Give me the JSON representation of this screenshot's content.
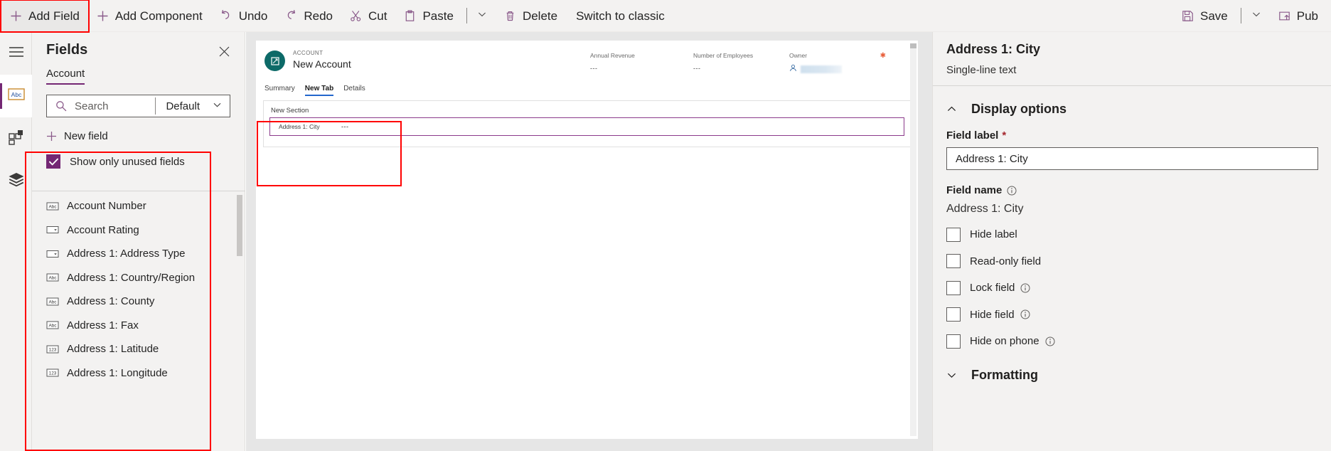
{
  "commandbar": {
    "left_items": [
      {
        "label": "Add Field",
        "icon": "plus-icon",
        "highlighted": true
      },
      {
        "label": "Add Component",
        "icon": "plus-icon"
      },
      {
        "label": "Undo",
        "icon": "undo-icon"
      },
      {
        "label": "Redo",
        "icon": "redo-icon"
      },
      {
        "label": "Cut",
        "icon": "scissors-icon"
      },
      {
        "label": "Paste",
        "icon": "clipboard-icon"
      },
      {
        "label": "Delete",
        "icon": "trash-icon"
      },
      {
        "label": "Switch to classic",
        "icon": "none"
      }
    ],
    "right_items": [
      {
        "label": "Save",
        "icon": "save-icon"
      },
      {
        "label": "Pub",
        "icon": "publish-icon"
      }
    ]
  },
  "rail": {
    "items": [
      {
        "name": "hamburger",
        "icon": "hamburger-icon",
        "active": false
      },
      {
        "name": "fields",
        "icon": "abc-box-icon",
        "active": true
      },
      {
        "name": "components",
        "icon": "components-grid-icon",
        "active": false
      },
      {
        "name": "layers",
        "icon": "layers-stack-icon",
        "active": false
      }
    ]
  },
  "fields_panel": {
    "title": "Fields",
    "close_label": "✕",
    "tab": "Account",
    "search": {
      "placeholder": "Search",
      "value": ""
    },
    "view_selector": {
      "label": "Default",
      "chevron": "chevron-down-icon"
    },
    "new_field_label": "New field",
    "unused_checkbox": {
      "label": "Show only unused fields",
      "checked": true
    },
    "items": [
      {
        "label": "Account Number",
        "type": "Abc"
      },
      {
        "label": "Account Rating",
        "type": "option"
      },
      {
        "label": "Address 1: Address Type",
        "type": "option"
      },
      {
        "label": "Address 1: Country/Region",
        "type": "Abc"
      },
      {
        "label": "Address 1: County",
        "type": "Abc"
      },
      {
        "label": "Address 1: Fax",
        "type": "Abc"
      },
      {
        "label": "Address 1: Latitude",
        "type": "123"
      },
      {
        "label": "Address 1: Longitude",
        "type": "123"
      }
    ]
  },
  "canvas": {
    "record": {
      "entity_label": "ACCOUNT",
      "record_name": "New Account"
    },
    "header_fields": [
      {
        "label": "Annual Revenue",
        "value": "---"
      },
      {
        "label": "Number of Employees",
        "value": "---"
      },
      {
        "label": "Owner",
        "value": ""
      }
    ],
    "tabs": [
      {
        "label": "Summary",
        "selected": false
      },
      {
        "label": "New Tab",
        "selected": true
      },
      {
        "label": "Details",
        "selected": false
      }
    ],
    "section": {
      "title": "New Section",
      "field": {
        "label": "Address 1: City",
        "value": "---"
      }
    }
  },
  "properties": {
    "title": "Address 1: City",
    "subtitle": "Single-line text",
    "display_options": {
      "heading": "Display options",
      "expanded": true,
      "field_label_title": "Field label",
      "field_label_required": "*",
      "field_label_value": "Address 1: City",
      "field_name_title": "Field name",
      "field_name_value": "Address 1: City",
      "checkboxes": [
        {
          "label": "Hide label",
          "checked": false,
          "info": false
        },
        {
          "label": "Read-only field",
          "checked": false,
          "info": false
        },
        {
          "label": "Lock field",
          "checked": false,
          "info": true
        },
        {
          "label": "Hide field",
          "checked": false,
          "info": true
        },
        {
          "label": "Hide on phone",
          "checked": false,
          "info": true
        }
      ]
    },
    "formatting": {
      "heading": "Formatting",
      "expanded": false
    }
  },
  "colors": {
    "accent_purple": "#742774",
    "highlight_red": "#ff0000",
    "tab_blue": "#2266cc",
    "avatar_teal": "#0d6a68",
    "required_red": "#a4262c"
  }
}
